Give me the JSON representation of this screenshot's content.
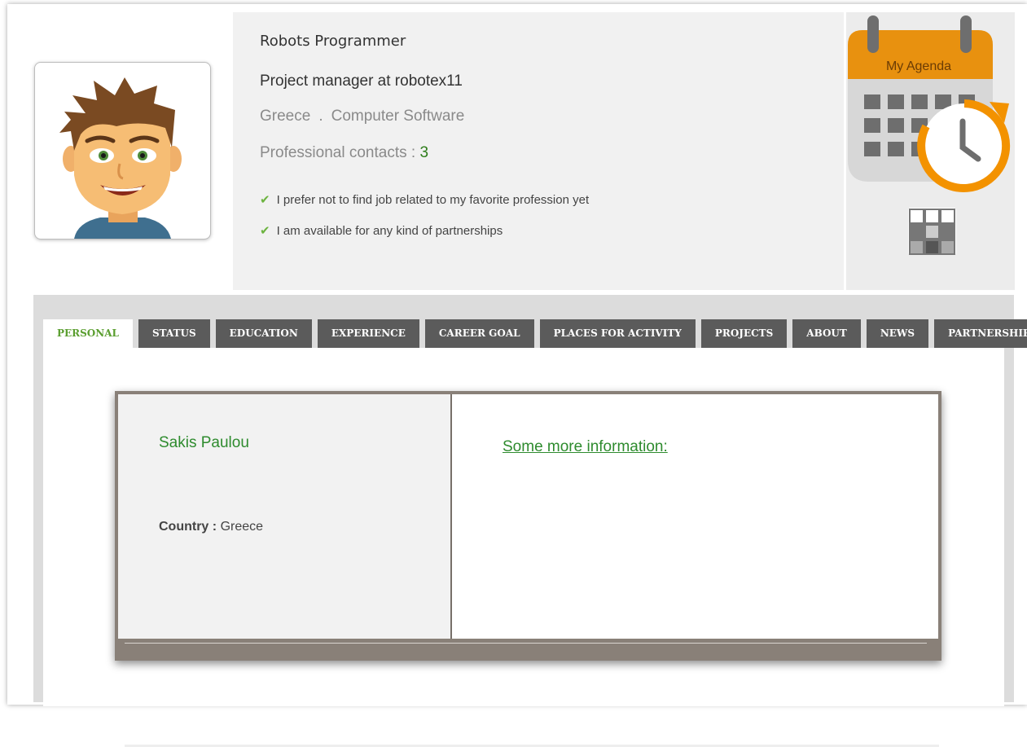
{
  "profile": {
    "title": "Robots Programmer",
    "job": "Project manager at robotex11",
    "country": "Greece",
    "separator": ".",
    "industry": "Computer Software",
    "contacts_label": "Professional contacts :",
    "contacts_count": "3",
    "preferences": [
      "I prefer not to find job related to my favorite profession yet",
      "I am available for any kind of partnerships"
    ]
  },
  "agenda": {
    "label": "My Agenda",
    "colors": {
      "header": "#e8910f",
      "clock": "#f39200",
      "body": "#d7d7d7"
    }
  },
  "tabs": [
    {
      "label": "PERSONAL",
      "active": true
    },
    {
      "label": "STATUS"
    },
    {
      "label": "EDUCATION"
    },
    {
      "label": "EXPERIENCE"
    },
    {
      "label": "CAREER GOAL"
    },
    {
      "label": "PLACES FOR ACTIVITY"
    },
    {
      "label": "PROJECTS"
    },
    {
      "label": "ABOUT"
    },
    {
      "label": "NEWS"
    },
    {
      "label": "PARTNERSHIPS"
    }
  ],
  "personal": {
    "name": "Sakis Paulou",
    "country_label": "Country :",
    "country_value": "Greece",
    "more_info_link": "Some more information:"
  },
  "colors": {
    "accent_green": "#2e8b2e",
    "tab_dark": "#5b5b5b",
    "check_green": "#6cb33f"
  }
}
